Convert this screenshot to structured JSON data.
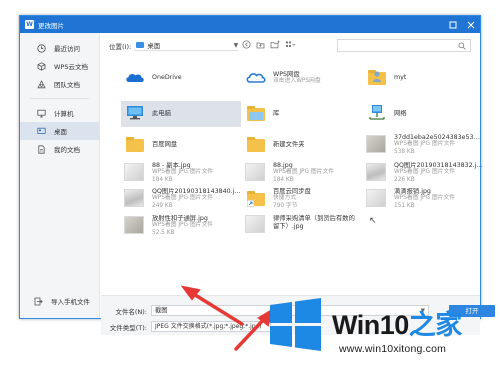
{
  "window": {
    "logo": "W",
    "title": "更改图片",
    "buttons": [
      "restore-icon",
      "close-icon"
    ],
    "accent": "#1f74d4"
  },
  "sidebar": {
    "items": [
      {
        "label": "最近访问",
        "icon": "clock-icon"
      },
      {
        "label": "WPS云文档",
        "icon": "cube-icon"
      },
      {
        "label": "团队文档",
        "icon": "team-icon"
      },
      {
        "label": "计算机",
        "icon": "monitor-icon"
      },
      {
        "label": "桌面",
        "icon": "desktop-icon",
        "active": true
      },
      {
        "label": "我的文档",
        "icon": "document-icon"
      }
    ],
    "bottom_label": "导入手机文件"
  },
  "toolbar": {
    "location_label": "位置(I):",
    "location_value": "桌面",
    "icons": [
      "back-icon",
      "up-folder-icon",
      "new-folder-icon",
      "view-menu-icon"
    ],
    "search_icon": "search-icon"
  },
  "files": [
    {
      "name": "OneDrive",
      "meta1": "",
      "meta2": "",
      "icon": "onedrive-icon"
    },
    {
      "name": "WPS网盘",
      "meta1": "双击进入WPS网盘",
      "meta2": "",
      "icon": "wps-cloud-icon"
    },
    {
      "name": "myt",
      "meta1": "",
      "meta2": "",
      "icon": "user-folder-icon"
    },
    {
      "name": "此电脑",
      "meta1": "",
      "meta2": "",
      "icon": "this-pc-icon",
      "selected": true
    },
    {
      "name": "库",
      "meta1": "",
      "meta2": "",
      "icon": "library-icon"
    },
    {
      "name": "网络",
      "meta1": "",
      "meta2": "",
      "icon": "network-icon"
    },
    {
      "name": "百度网盘",
      "meta1": "",
      "meta2": "",
      "icon": "folder-icon"
    },
    {
      "name": "新建文件夹",
      "meta1": "",
      "meta2": "",
      "icon": "folder-icon"
    },
    {
      "name": "37dd1eba2e5024383e5306f9...",
      "meta1": "WPS看图 JPG 图片文件",
      "meta2": "538 KB",
      "icon": "image-thumbnail"
    },
    {
      "name": "88 - 副本.jpg",
      "meta1": "WPS看图 JPG 图片文件",
      "meta2": "184 KB",
      "icon": "image-thumbnail"
    },
    {
      "name": "88.jpg",
      "meta1": "WPS看图 JPG 图片文件",
      "meta2": "184 KB",
      "icon": "image-thumbnail"
    },
    {
      "name": "QQ图片20190318143832.jpg",
      "meta1": "WPS看图 JPG 图片文件",
      "meta2": "226 KB",
      "icon": "image-thumbnail"
    },
    {
      "name": "QQ图片20190318143840.jpg",
      "meta1": "WPS看图 JPG 图片文件",
      "meta2": "249 KB",
      "icon": "image-thumbnail"
    },
    {
      "name": "百度云同步盘",
      "meta1": "快捷方式",
      "meta2": "790 字节",
      "icon": "shortcut-icon"
    },
    {
      "name": "滴滴报销.jpg",
      "meta1": "WPS看图 JPG 图片文件",
      "meta2": "151 KB",
      "icon": "image-thumbnail"
    },
    {
      "name": "放射性和子通屏.jpg",
      "meta1": "WPS看图 JPG 图片文件",
      "meta2": "52.5 KB",
      "icon": "image-thumbnail"
    },
    {
      "name": "律师采购清单（到货后有数的留下）.jpg",
      "meta1": "",
      "meta2": "",
      "icon": "image-thumbnail"
    }
  ],
  "footer": {
    "filename_label": "文件名(N):",
    "filename_value": "截图",
    "filetype_label": "文件类型(T):",
    "filetype_value": "JPEG 文件交换格式(*.jpg;*.jpeg;*.jpe)",
    "open_label": "打开"
  },
  "watermark": {
    "brand_win": "Win10",
    "brand_zhi": "之家",
    "url": "www.win10xitong.com",
    "logo_color": "#1e88e5",
    "arrow_color": "#e53935"
  }
}
